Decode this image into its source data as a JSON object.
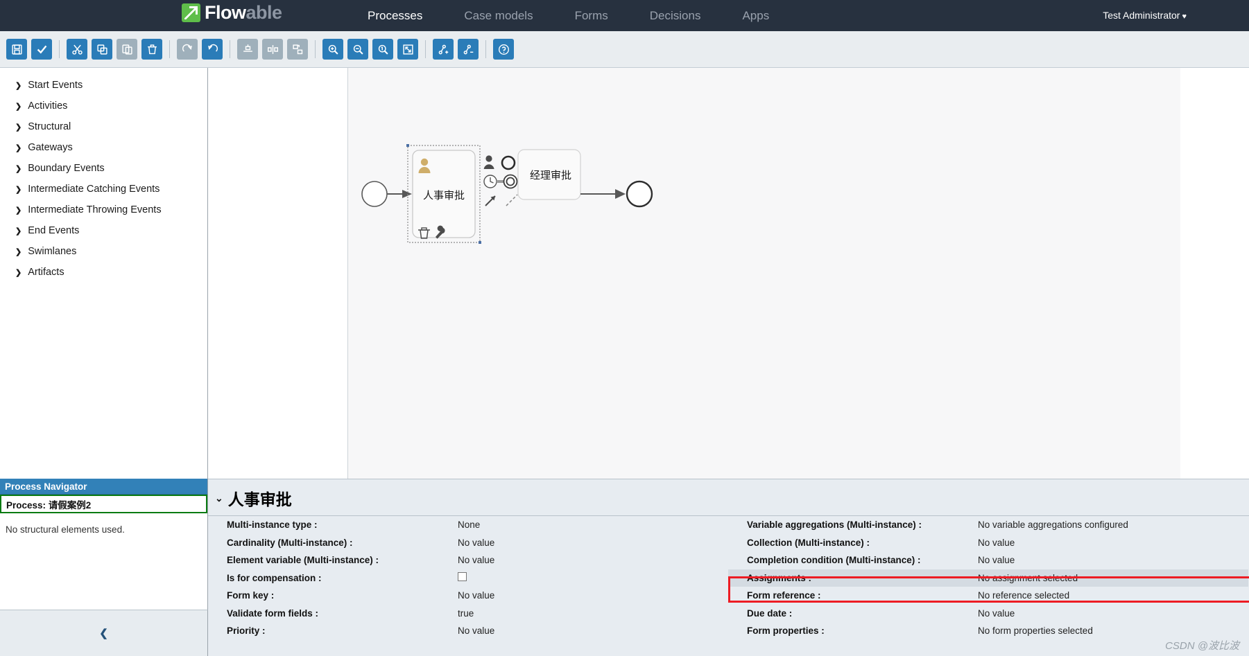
{
  "topnav": {
    "brand_main": "Flow",
    "brand_dim": "able",
    "tabs": [
      {
        "label": "Processes",
        "active": true
      },
      {
        "label": "Case models",
        "active": false
      },
      {
        "label": "Forms",
        "active": false
      },
      {
        "label": "Decisions",
        "active": false
      },
      {
        "label": "Apps",
        "active": false
      }
    ],
    "user": "Test Administrator",
    "user_caret": "♥"
  },
  "toolbar": {
    "groups": [
      {
        "buttons": [
          {
            "name": "save-button",
            "icon": "save-icon",
            "enabled": true
          },
          {
            "name": "validate-button",
            "icon": "check-icon",
            "enabled": true
          }
        ]
      },
      {
        "buttons": [
          {
            "name": "cut-button",
            "icon": "scissors-icon",
            "enabled": true
          },
          {
            "name": "copy-button",
            "icon": "copy-icon",
            "enabled": true
          },
          {
            "name": "paste-button",
            "icon": "paste-icon",
            "enabled": false
          },
          {
            "name": "delete-button",
            "icon": "trash-icon",
            "enabled": true
          }
        ]
      },
      {
        "buttons": [
          {
            "name": "redo-button",
            "icon": "redo-icon",
            "enabled": false
          },
          {
            "name": "undo-button",
            "icon": "undo-icon",
            "enabled": true
          }
        ]
      },
      {
        "buttons": [
          {
            "name": "align-vertical-button",
            "icon": "align-vertical-icon",
            "enabled": false
          },
          {
            "name": "align-horizontal-button",
            "icon": "align-horizontal-icon",
            "enabled": false
          },
          {
            "name": "same-size-button",
            "icon": "same-size-icon",
            "enabled": false
          }
        ]
      },
      {
        "buttons": [
          {
            "name": "zoom-in-button",
            "icon": "zoom-in-icon",
            "enabled": true
          },
          {
            "name": "zoom-out-button",
            "icon": "zoom-out-icon",
            "enabled": true
          },
          {
            "name": "zoom-actual-button",
            "icon": "zoom-actual-icon",
            "enabled": true
          },
          {
            "name": "zoom-fit-button",
            "icon": "zoom-fit-icon",
            "enabled": true
          }
        ]
      },
      {
        "buttons": [
          {
            "name": "add-bendpoint-button",
            "icon": "add-bendpoint-icon",
            "enabled": true
          },
          {
            "name": "remove-bendpoint-button",
            "icon": "remove-bendpoint-icon",
            "enabled": true
          }
        ]
      },
      {
        "buttons": [
          {
            "name": "help-button",
            "icon": "question-mark-icon",
            "enabled": true
          }
        ]
      }
    ]
  },
  "palette": {
    "items": [
      {
        "label": "Start Events"
      },
      {
        "label": "Activities"
      },
      {
        "label": "Structural"
      },
      {
        "label": "Gateways"
      },
      {
        "label": "Boundary Events"
      },
      {
        "label": "Intermediate Catching Events"
      },
      {
        "label": "Intermediate Throwing Events"
      },
      {
        "label": "End Events"
      },
      {
        "label": "Swimlanes"
      },
      {
        "label": "Artifacts"
      }
    ]
  },
  "diagram": {
    "start_event": {
      "name": "start-event"
    },
    "task_selected": {
      "label": "人事审批",
      "type": "user-task"
    },
    "task_second": {
      "label": "经理审批",
      "type": "user-task"
    },
    "end_event": {
      "name": "end-event"
    },
    "quickmenu": [
      "user-task-icon",
      "task-icon",
      "exclusive-gateway-icon",
      "timer-event-icon",
      "end-event-icon",
      "sequence-flow-icon",
      "association-icon"
    ],
    "context_actions": [
      "delete-icon",
      "morph-icon"
    ]
  },
  "process_navigator": {
    "title": "Process Navigator",
    "process_label": "Process:",
    "process_name": "请假案例2",
    "empty_text": "No structural elements used.",
    "collapse_icon": "❮"
  },
  "properties": {
    "title": "人事审批",
    "collapse_chevron": "⌄",
    "left_rows": [
      {
        "label": "Multi-instance type :",
        "value": "None",
        "type": "text",
        "highlight": false
      },
      {
        "label": "Cardinality (Multi-instance) :",
        "value": "No value",
        "type": "text",
        "highlight": false
      },
      {
        "label": "Element variable (Multi-instance) :",
        "value": "No value",
        "type": "text",
        "highlight": false
      },
      {
        "label": "Is for compensation :",
        "value": "",
        "type": "checkbox",
        "highlight": false
      },
      {
        "label": "Form key :",
        "value": "No value",
        "type": "text",
        "highlight": false
      },
      {
        "label": "Validate form fields :",
        "value": "true",
        "type": "text",
        "highlight": false
      },
      {
        "label": "Priority :",
        "value": "No value",
        "type": "text",
        "highlight": false
      }
    ],
    "right_rows": [
      {
        "label": "Variable aggregations (Multi-instance) :",
        "value": "No variable aggregations configured",
        "type": "text",
        "highlight": false
      },
      {
        "label": "Collection (Multi-instance) :",
        "value": "No value",
        "type": "text",
        "highlight": false
      },
      {
        "label": "Completion condition (Multi-instance) :",
        "value": "No value",
        "type": "text",
        "highlight": false
      },
      {
        "label": "Assignments :",
        "value": "No assignment selected",
        "type": "text",
        "highlight": true
      },
      {
        "label": "Form reference :",
        "value": "No reference selected",
        "type": "text",
        "highlight": false
      },
      {
        "label": "Due date :",
        "value": "No value",
        "type": "text",
        "highlight": false
      },
      {
        "label": "Form properties :",
        "value": "No form properties selected",
        "type": "text",
        "highlight": false
      }
    ],
    "watermark": "CSDN @波比波"
  },
  "colors": {
    "nav_bg": "#27313f",
    "toolbar_bg": "#e9edf0",
    "btn_active": "#2a7cb8",
    "btn_disabled": "#9fb0bb",
    "brand_green": "#5fbe4a",
    "panel_bg": "#e7ecf1",
    "highlight_red": "#ed1c24",
    "navigator_blue": "#3281b8",
    "process_green": "#0a7b12"
  }
}
